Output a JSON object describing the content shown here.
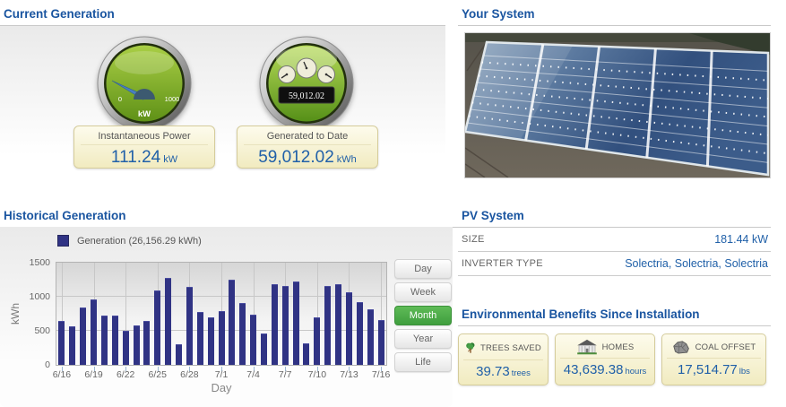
{
  "sections": {
    "current_generation": "Current Generation",
    "your_system": "Your System",
    "historical_generation": "Historical Generation",
    "pv_system": "PV System",
    "environmental_benefits": "Environmental Benefits Since Installation"
  },
  "gauges": {
    "power": {
      "dial_min": "0",
      "dial_max": "1000",
      "dial_unit": "kW",
      "label": "Instantaneous Power",
      "value": "111.24",
      "unit": "kW"
    },
    "generated": {
      "odometer": "59,012.02",
      "label": "Generated to Date",
      "value": "59,012.02",
      "unit": "kWh"
    }
  },
  "chart_controls": [
    {
      "label": "Day",
      "active": false
    },
    {
      "label": "Week",
      "active": false
    },
    {
      "label": "Month",
      "active": true
    },
    {
      "label": "Year",
      "active": false
    },
    {
      "label": "Life",
      "active": false
    }
  ],
  "chart_data": {
    "type": "bar",
    "legend_label": "Generation (26,156.29 kWh)",
    "total": "26,156.29 kWh",
    "xlabel": "Day",
    "ylabel": "kWh",
    "ylim": [
      0,
      1500
    ],
    "yticks": [
      0,
      500,
      1000,
      1500
    ],
    "xtick_every": 3,
    "xtick_labels": [
      "6/16",
      "6/19",
      "6/22",
      "6/25",
      "6/28",
      "7/1",
      "7/4",
      "7/7",
      "7/10",
      "7/13",
      "7/16"
    ],
    "bar_color": "#303384",
    "grid": true,
    "legend_position": "top-left",
    "categories": [
      "6/16",
      "6/17",
      "6/18",
      "6/19",
      "6/20",
      "6/21",
      "6/22",
      "6/23",
      "6/24",
      "6/25",
      "6/26",
      "6/27",
      "6/28",
      "6/29",
      "6/30",
      "7/1",
      "7/2",
      "7/3",
      "7/4",
      "7/5",
      "7/6",
      "7/7",
      "7/8",
      "7/9",
      "7/10",
      "7/11",
      "7/12",
      "7/13",
      "7/14",
      "7/15",
      "7/16"
    ],
    "values": [
      640,
      560,
      840,
      960,
      725,
      725,
      495,
      580,
      645,
      1090,
      1275,
      300,
      1140,
      780,
      700,
      790,
      1255,
      905,
      740,
      465,
      1180,
      1160,
      1230,
      320,
      700,
      1160,
      1190,
      1070,
      925,
      815,
      655
    ]
  },
  "pv_system": {
    "rows": [
      {
        "label": "SIZE",
        "value": "181.44 kW"
      },
      {
        "label": "INVERTER TYPE",
        "value": "Solectria, Solectria, Solectria"
      }
    ]
  },
  "environment": {
    "cards": [
      {
        "icon": "tree-icon",
        "label": "TREES SAVED",
        "value": "39.73",
        "unit": "trees"
      },
      {
        "icon": "house-icon",
        "label": "HOMES",
        "value": "43,639.38",
        "unit": "hours"
      },
      {
        "icon": "coal-icon",
        "label": "COAL OFFSET",
        "value": "17,514.77",
        "unit": "lbs"
      }
    ]
  },
  "colors": {
    "heading": "#1a55a0",
    "value_blue": "#2060a8",
    "bar": "#303384",
    "active_button": "#4aa546"
  }
}
